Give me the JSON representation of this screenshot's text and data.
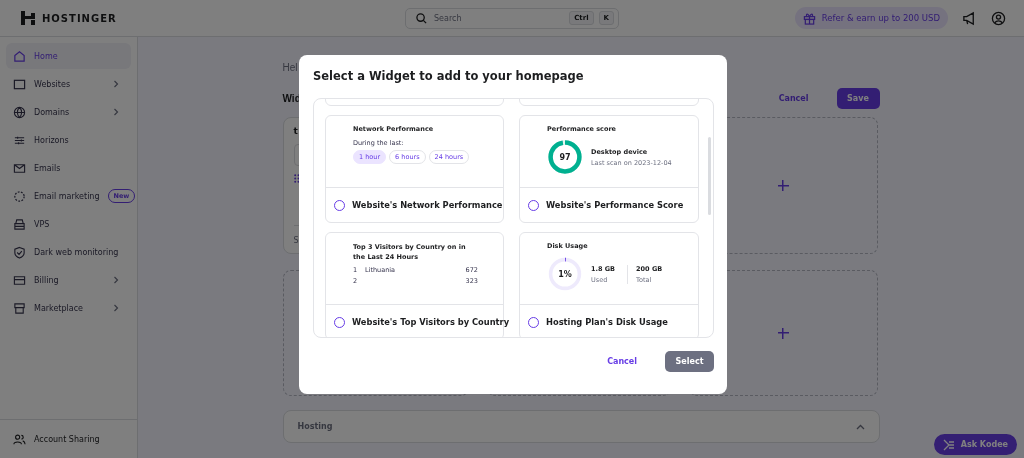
{
  "header": {
    "logo": "HOSTINGER",
    "search": {
      "placeholder": "Search",
      "keys": [
        "Ctrl",
        "K"
      ]
    },
    "refer": "Refer & earn up to 200 USD"
  },
  "sidebar": {
    "items": [
      {
        "label": "Home",
        "selected": true
      },
      {
        "label": "Websites",
        "selected": false,
        "expandable": true
      },
      {
        "label": "Domains",
        "selected": false,
        "expandable": true
      },
      {
        "label": "Horizons",
        "selected": false
      },
      {
        "label": "Emails",
        "selected": false
      },
      {
        "label": "Email marketing",
        "selected": false,
        "badge": "New"
      },
      {
        "label": "VPS",
        "selected": false
      },
      {
        "label": "Dark web monitoring",
        "selected": false
      },
      {
        "label": "Billing",
        "selected": false,
        "expandable": true
      },
      {
        "label": "Marketplace",
        "selected": false,
        "expandable": true
      }
    ],
    "footer": "Account Sharing"
  },
  "page": {
    "breadcrumb": "Hel",
    "heading": "Wid",
    "cancel": "Cancel",
    "save": "Save",
    "widget": {
      "title": "t",
      "footer": "S"
    },
    "hosting": "Hosting"
  },
  "modal": {
    "title": "Select a Widget to add to your homepage",
    "widgets": [
      {
        "kind": "network",
        "name": "Website's Network Performance",
        "selected": false,
        "title": "Network Performance",
        "subtitle": "During the last:",
        "options": [
          {
            "label": "1 hour",
            "selected": true
          },
          {
            "label": "6 hours",
            "selected": false
          },
          {
            "label": "24 hours",
            "selected": false
          }
        ]
      },
      {
        "kind": "score",
        "name": "Website's Performance Score",
        "selected": false,
        "title": "Performance score",
        "score": "97",
        "level": 0.97,
        "device": "Desktop device",
        "last_scan": "Last scan on 2023-12-04"
      },
      {
        "kind": "visitors",
        "name": "Website's Top Visitors by Country",
        "selected": false,
        "title": "Top 3 Visitors by Country on in the Last 24 Hours",
        "rows": [
          {
            "rank": "1",
            "country": "Lithuania",
            "count": "672"
          },
          {
            "rank": "2",
            "count": "323"
          }
        ]
      },
      {
        "kind": "disk",
        "name": "Hosting Plan's Disk Usage",
        "selected": false,
        "title": "Disk Usage",
        "percent": "1%",
        "level": 0.01,
        "used": "1.8 GB",
        "used_label": "Used",
        "total": "200 GB",
        "total_label": "Total"
      }
    ],
    "cancel": "Cancel",
    "select": "Select"
  },
  "assistant": "Ask Kodee"
}
